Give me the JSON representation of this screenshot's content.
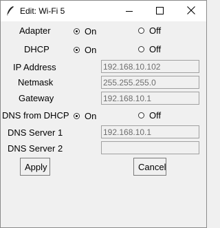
{
  "window": {
    "title": "Edit: Wi-Fi 5"
  },
  "adapter": {
    "label": "Adapter",
    "on_label": "On",
    "off_label": "Off",
    "selected": "On"
  },
  "dhcp": {
    "label": "DHCP",
    "on_label": "On",
    "off_label": "Off",
    "selected": "On"
  },
  "ip_address": {
    "label": "IP Address",
    "value": "192.168.10.102"
  },
  "netmask": {
    "label": "Netmask",
    "value": "255.255.255.0"
  },
  "gateway": {
    "label": "Gateway",
    "value": "192.168.10.1"
  },
  "dns_from_dhcp": {
    "label": "DNS from DHCP",
    "on_label": "On",
    "off_label": "Off",
    "selected": "On"
  },
  "dns_server_1": {
    "label": "DNS Server 1",
    "value": "192.168.10.1"
  },
  "dns_server_2": {
    "label": "DNS Server 2",
    "value": ""
  },
  "buttons": {
    "apply": "Apply",
    "cancel": "Cancel"
  },
  "icons": {
    "app": "feather-icon",
    "minimize": "minimize-icon",
    "maximize": "maximize-icon",
    "close": "close-icon"
  }
}
